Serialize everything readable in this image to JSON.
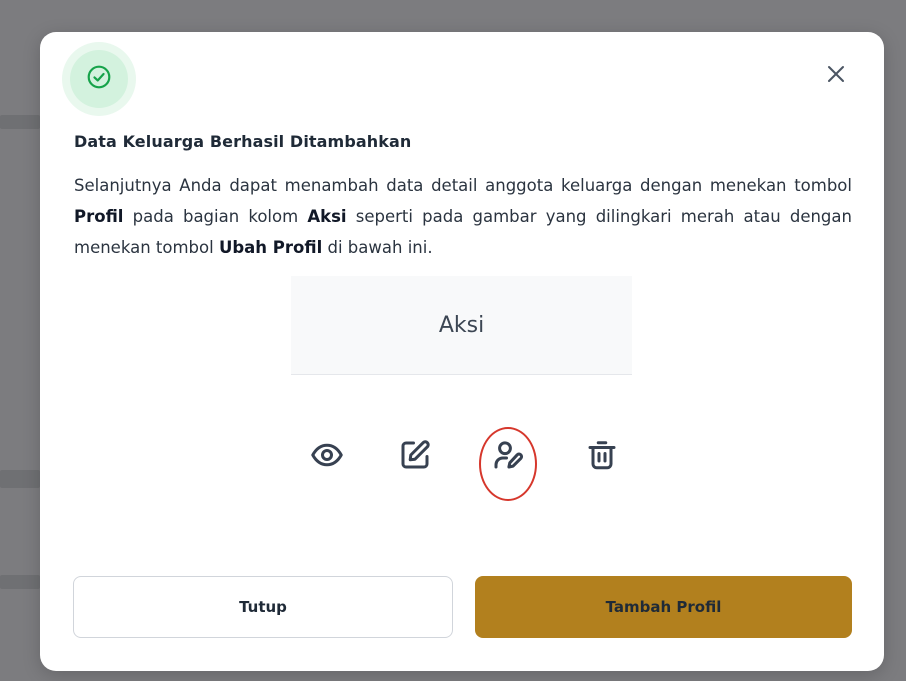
{
  "dialog": {
    "title": "Data Keluarga Berhasil Ditambahkan",
    "body": {
      "p1": "Selanjutnya Anda dapat menambah data detail anggota keluarga dengan menekan tombol ",
      "bold1": "Profil",
      "p2": " pada bagian kolom ",
      "bold2": "Aksi",
      "p3": " seperti pada gambar yang dilingkari merah atau dengan menekan tombol ",
      "bold3": "Ubah Profil",
      "p4": " di bawah ini."
    },
    "icons": {
      "status": "check-circle-icon",
      "close": "close-icon"
    }
  },
  "illustration": {
    "column_header": "Aksi",
    "action_icons": [
      "eye-icon",
      "edit-icon",
      "user-edit-icon",
      "trash-icon"
    ],
    "highlighted_icon": "user-edit-icon",
    "highlight_color": "#d6372c"
  },
  "buttons": {
    "close_label": "Tutup",
    "add_profile_label": "Tambah Profil"
  },
  "colors": {
    "success": "#16a34a",
    "primary": "#b2801e",
    "icon": "#374151"
  }
}
